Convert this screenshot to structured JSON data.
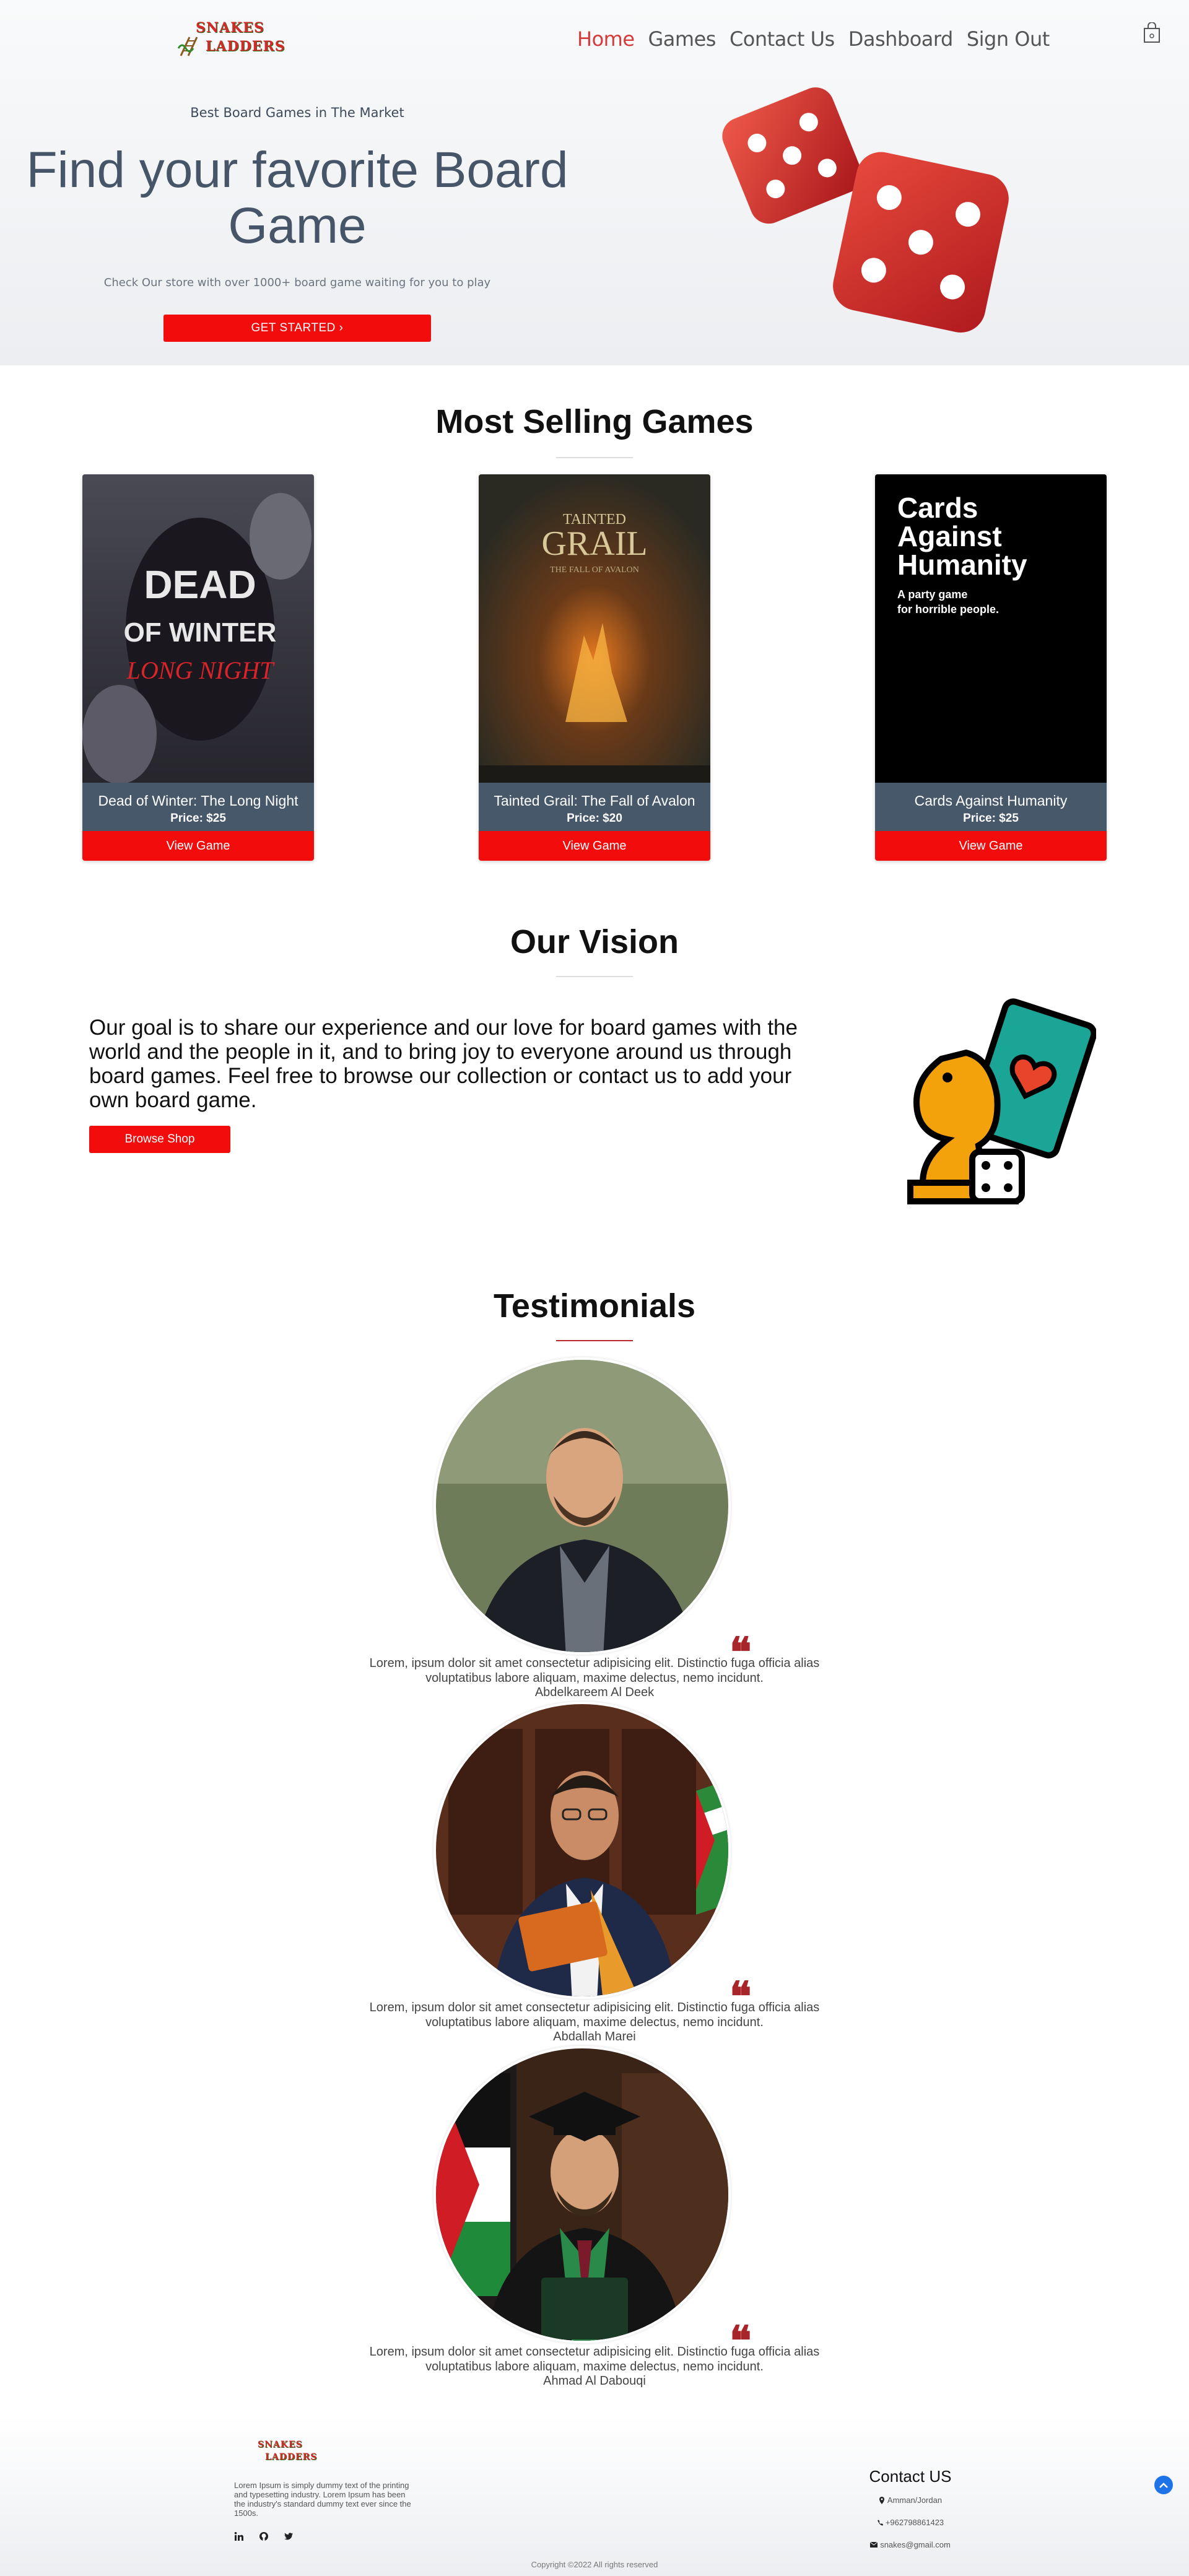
{
  "header": {
    "logo_top": "SNAKES",
    "logo_bottom": "LADDERS",
    "nav": [
      {
        "label": "Home"
      },
      {
        "label": "Games"
      },
      {
        "label": "Contact Us"
      },
      {
        "label": "Dashboard"
      },
      {
        "label": "Sign Out"
      }
    ],
    "cart_icon": "shopping-bag-icon"
  },
  "hero": {
    "kicker": "Best Board Games in The Market",
    "title_line1": "Find your favorite Board",
    "title_line2": "Game",
    "subtitle": "Check Our store with over 1000+ board game waiting for you to play",
    "cta": "GET STARTED ›"
  },
  "most_selling": {
    "title": "Most Selling Games",
    "button_label": "View Game",
    "games": [
      {
        "name": "Dead of Winter: The Long Night",
        "price": "Price: $25",
        "cover_title": "DEAD OF WINTER",
        "cover_sub": "LONG NIGHT"
      },
      {
        "name": "Tainted Grail: The Fall of Avalon",
        "price": "Price: $20",
        "cover_title": "TAINTED GRAIL",
        "cover_sub": "THE FALL OF AVALON"
      },
      {
        "name": "Cards Against Humanity",
        "price": "Price: $25",
        "cover_title": "Cards Against Humanity",
        "cover_sub": "A party game for horrible people."
      }
    ]
  },
  "vision": {
    "title": "Our Vision",
    "text": "Our goal is to share our experience and our love for board games with the world and the people in it, and to bring joy to everyone around us through board games. Feel free to browse our collection or contact us to add your own board game.",
    "button": "Browse Shop"
  },
  "testimonials": {
    "title": "Testimonials",
    "quote_glyph": "❝",
    "items": [
      {
        "text": "Lorem, ipsum dolor sit amet consectetur adipisicing elit. Distinctio fuga officia alias voluptatibus labore aliquam, maxime delectus, nemo incidunt.",
        "name": "Abdelkareem Al Deek"
      },
      {
        "text": "Lorem, ipsum dolor sit amet consectetur adipisicing elit. Distinctio fuga officia alias voluptatibus labore aliquam, maxime delectus, nemo incidunt.",
        "name": "Abdallah Marei"
      },
      {
        "text": "Lorem, ipsum dolor sit amet consectetur adipisicing elit. Distinctio fuga officia alias voluptatibus labore aliquam, maxime delectus, nemo incidunt.",
        "name": "Ahmad Al Dabouqi"
      }
    ]
  },
  "footer": {
    "about": "Lorem Ipsum is simply dummy text of the printing and typesetting industry. Lorem Ipsum has been the industry's standard dummy text ever since the 1500s.",
    "social": [
      "linkedin-icon",
      "github-icon",
      "twitter-icon"
    ],
    "contact_title": "Contact US",
    "address": "Amman/Jordan",
    "phone": "+962798861423",
    "email": "snakes@gmail.com",
    "copyright": "Copyright ©2022 All rights reserved"
  },
  "colors": {
    "accent_red": "#f20c0c",
    "nav_active": "#d63a3a",
    "card_info_bg": "#47586b",
    "quote_red": "#a8262a"
  }
}
